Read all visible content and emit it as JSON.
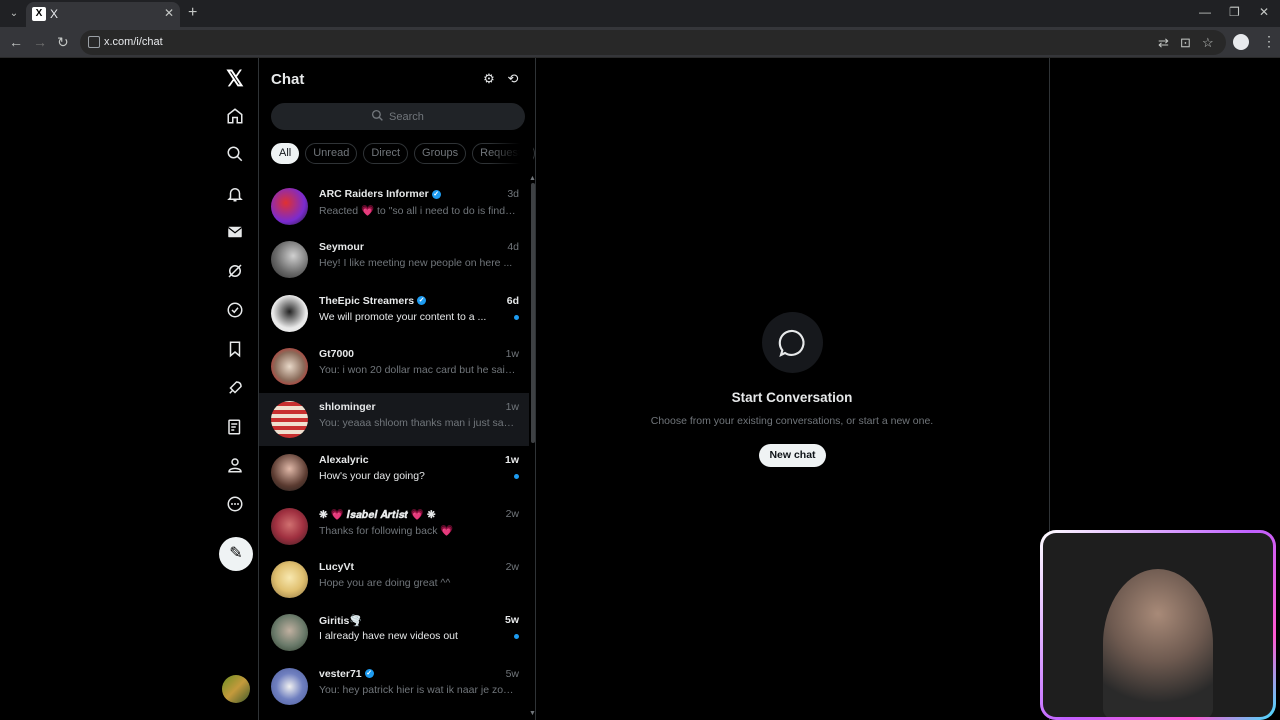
{
  "browser": {
    "tab_title": "X",
    "tab_favicon": "X",
    "url": "x.com/i/chat",
    "new_tab": "+"
  },
  "chat": {
    "title": "Chat",
    "search_placeholder": "Search",
    "filters": [
      "All",
      "Unread",
      "Direct",
      "Groups",
      "Requests"
    ],
    "conversations": [
      {
        "name": "ARC Raiders Informer",
        "verified": true,
        "time": "3d",
        "preview": "Reacted 💗 to \"so all i need to do is find o...",
        "unread": false
      },
      {
        "name": "Seymour",
        "verified": false,
        "time": "4d",
        "preview": "Hey! I like meeting new people on here ...",
        "unread": false
      },
      {
        "name": "TheEpic Streamers",
        "verified": true,
        "time": "6d",
        "preview": "We will promote your content to a ...",
        "unread": true
      },
      {
        "name": "Gt7000",
        "verified": false,
        "time": "1w",
        "preview": "You: i won 20 dollar mac card but he said i...",
        "unread": false
      },
      {
        "name": "shlominger",
        "verified": false,
        "time": "1w",
        "preview": "You: yeaaa shloom thanks man i just saw i...",
        "unread": false
      },
      {
        "name": "Alexalyric",
        "verified": false,
        "time": "1w",
        "preview": "How's your day going?",
        "unread": true
      },
      {
        "name": "❋ 💗 𝑰𝒔𝒂𝒃𝒆𝒍 𝑨𝒓𝒕𝒊𝒔𝒕 💗 ❋",
        "verified": false,
        "time": "2w",
        "preview": "Thanks for following back 💗",
        "unread": false
      },
      {
        "name": "LucyVt",
        "verified": false,
        "time": "2w",
        "preview": "Hope you are doing great ^^",
        "unread": false
      },
      {
        "name": "Giritis🌪️",
        "verified": false,
        "time": "5w",
        "preview": "I already have new videos out",
        "unread": true
      },
      {
        "name": "vester71",
        "verified": true,
        "time": "5w",
        "preview": "You: hey patrick hier is wat ik naar je zou ...",
        "unread": false
      }
    ]
  },
  "main": {
    "title": "Start Conversation",
    "subtitle": "Choose from your existing conversations, or start a new one.",
    "new_chat_label": "New chat"
  },
  "colors": {
    "background": "#000000",
    "text_primary": "#e7e9ea",
    "text_secondary": "#71767b",
    "accent_blue": "#1d9bf0",
    "border": "#2f3336"
  },
  "avatars": [
    "#7a2bd0",
    "#6a6a6a",
    "#e9e9e9",
    "#8a6b5a",
    "#b84040",
    "#c49a8a",
    "#a03040",
    "#e0c070",
    "#6a7a6a",
    "#7080c0"
  ]
}
